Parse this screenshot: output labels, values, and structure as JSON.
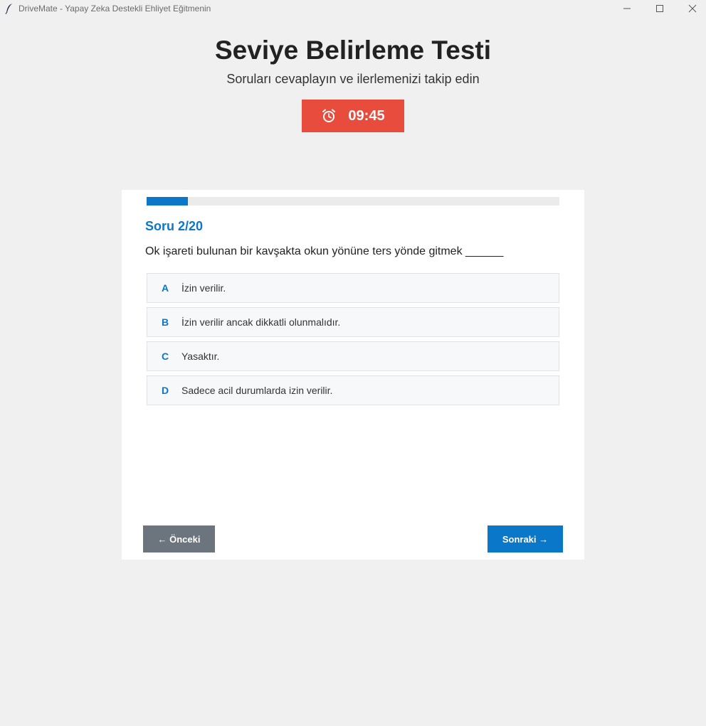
{
  "window": {
    "title": "DriveMate - Yapay Zeka Destekli Ehliyet Eğitmenin",
    "app_icon": "feather-icon",
    "controls": [
      "minimize-icon",
      "maximize-icon",
      "close-icon"
    ]
  },
  "header": {
    "title": "Seviye Belirleme Testi",
    "subtitle": "Soruları cevaplayın ve ilerlemenizi takip edin"
  },
  "timer": {
    "icon": "alarm-clock-icon",
    "value": "09:45",
    "color": "#e74c3c"
  },
  "progress": {
    "fraction": 0.1,
    "color": "#0a77c8"
  },
  "question": {
    "number_label": "Soru 2/20",
    "text": "Ok işareti bulunan bir kavşakta okun yönüne ters yönde gitmek ______",
    "options": [
      {
        "letter": "A",
        "text": "İzin verilir."
      },
      {
        "letter": "B",
        "text": "İzin verilir ancak dikkatli olunmalıdır."
      },
      {
        "letter": "C",
        "text": "Yasaktır."
      },
      {
        "letter": "D",
        "text": "Sadece acil durumlarda izin verilir."
      }
    ]
  },
  "navigation": {
    "prev_label": "← Önceki",
    "next_label": "Sonraki →",
    "prev_color": "#6c757d",
    "next_color": "#0a77c8"
  },
  "colors": {
    "accent": "#0a77c8",
    "background": "#f0f0f0",
    "card": "#ffffff"
  }
}
